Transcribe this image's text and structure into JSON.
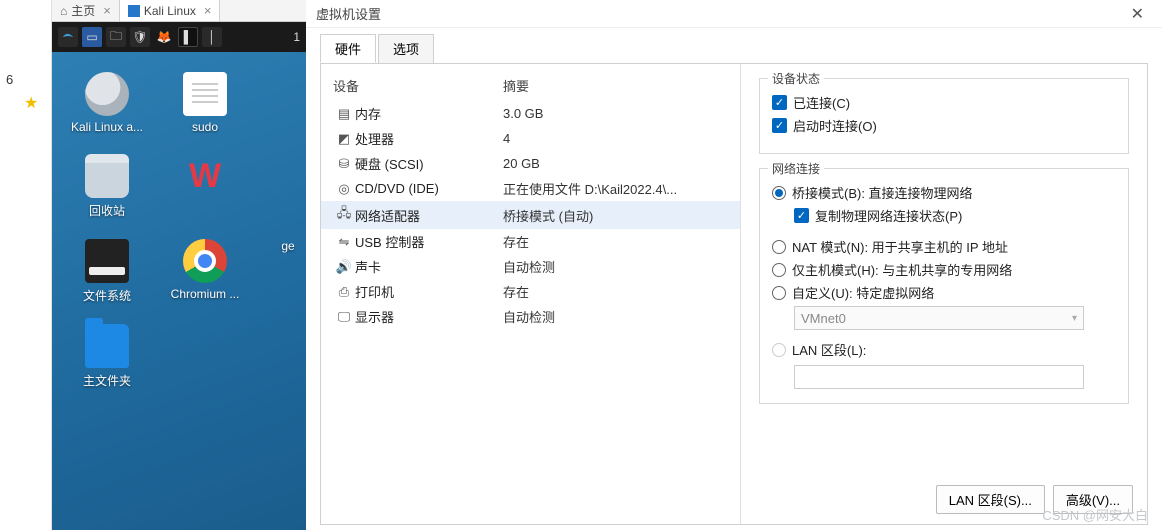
{
  "sidepane": {
    "page": "6",
    "star": "★"
  },
  "tabs": {
    "home": "主页",
    "kali": "Kali Linux"
  },
  "desktop": {
    "taskbar_clock": "1",
    "icons": [
      {
        "label": "Kali Linux a...",
        "kind": "disc"
      },
      {
        "label": "sudo",
        "kind": "txt"
      },
      {
        "label": "",
        "kind": "blank"
      },
      {
        "label": "回收站",
        "kind": "trash"
      },
      {
        "label": "W",
        "kind": "wcut"
      },
      {
        "label": "",
        "kind": "blank"
      },
      {
        "label": "文件系统",
        "kind": "drive"
      },
      {
        "label": "Chromium ...",
        "kind": "chrome"
      },
      {
        "label": "ge",
        "kind": "blank2"
      },
      {
        "label": "主文件夹",
        "kind": "folder"
      }
    ]
  },
  "dialog": {
    "title": "虚拟机设置",
    "close": "✕",
    "tab_hw": "硬件",
    "tab_opt": "选项",
    "hdr_device": "设备",
    "hdr_summary": "摘要",
    "rows": [
      {
        "icon": "memory",
        "name": "内存",
        "summary": "3.0 GB"
      },
      {
        "icon": "cpu",
        "name": "处理器",
        "summary": "4"
      },
      {
        "icon": "disk",
        "name": "硬盘 (SCSI)",
        "summary": "20 GB"
      },
      {
        "icon": "cd",
        "name": "CD/DVD (IDE)",
        "summary": "正在使用文件 D:\\Kail2022.4\\..."
      },
      {
        "icon": "net",
        "name": "网络适配器",
        "summary": "桥接模式 (自动)"
      },
      {
        "icon": "usb",
        "name": "USB 控制器",
        "summary": "存在"
      },
      {
        "icon": "sound",
        "name": "声卡",
        "summary": "自动检测"
      },
      {
        "icon": "printer",
        "name": "打印机",
        "summary": "存在"
      },
      {
        "icon": "display",
        "name": "显示器",
        "summary": "自动检测"
      }
    ],
    "grp_state": "设备状态",
    "chk_connected": "已连接(C)",
    "chk_poweron": "启动时连接(O)",
    "grp_net": "网络连接",
    "rad_bridge": "桥接模式(B): 直接连接物理网络",
    "chk_copy": "复制物理网络连接状态(P)",
    "rad_nat": "NAT 模式(N): 用于共享主机的 IP 地址",
    "rad_host": "仅主机模式(H): 与主机共享的专用网络",
    "rad_custom": "自定义(U): 特定虚拟网络",
    "vmnet": "VMnet0",
    "rad_lan": "LAN 区段(L):",
    "btn_lanseg": "LAN 区段(S)...",
    "btn_adv": "高级(V)..."
  },
  "watermark": "CSDN @网安大白"
}
